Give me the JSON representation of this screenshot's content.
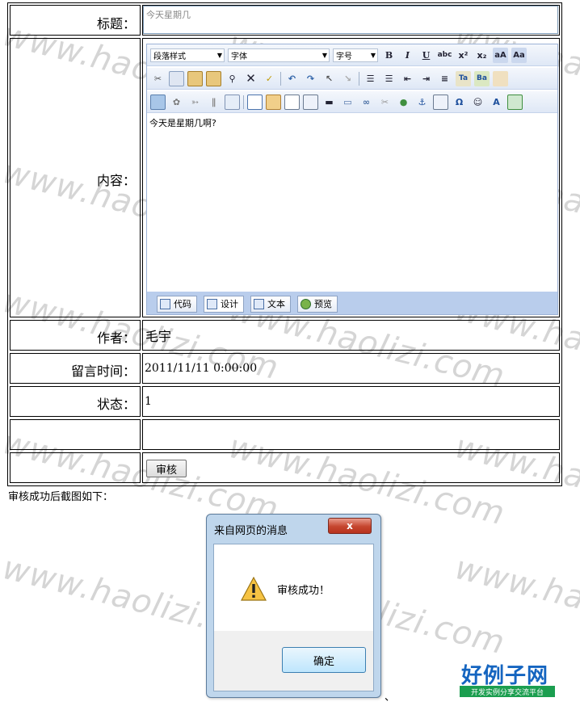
{
  "watermark": "www.haolizi.com",
  "form": {
    "title_label": "标题：",
    "title_value": "今天星期几",
    "content_label": "内容：",
    "author_label": "作者：",
    "author_value": "毛宇",
    "time_label": "留言时间：",
    "time_value": "2011/11/11 0:00:00",
    "status_label": "状态：",
    "status_value": "1",
    "audit_button": "审核"
  },
  "editor": {
    "paragraph_style": "段落样式",
    "font": "字体",
    "font_size": "字号",
    "content": "今天是星期几啊?",
    "modes": [
      "代码",
      "设计",
      "文本",
      "预览"
    ]
  },
  "caption": "审核成功后截图如下：",
  "dialog": {
    "title": "来自网页的消息",
    "close": "x",
    "message": "审核成功！",
    "ok": "确定"
  },
  "trailing_mark": "、",
  "logo": {
    "main": "好例子网",
    "sub": "开发实例分享交流平台"
  },
  "colors": {
    "editor_bar": "#b9cdec",
    "logo_blue": "#1565c0",
    "logo_green": "#1b9e4f"
  }
}
